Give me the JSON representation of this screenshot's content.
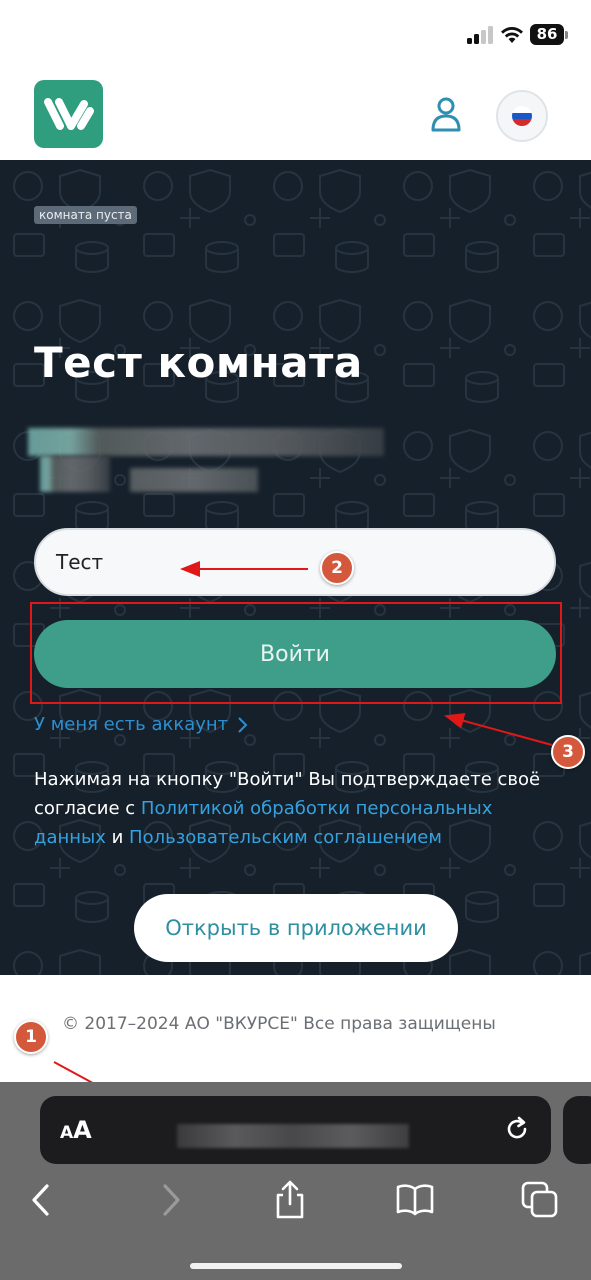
{
  "status_bar": {
    "battery": "86"
  },
  "header": {
    "logo_icon": "app-logo-icon",
    "user_icon": "user-icon",
    "language_icon": "russian-flag-icon"
  },
  "room": {
    "badge": "комната пуста",
    "title": "Тест комната"
  },
  "form": {
    "name_value": "Тест",
    "login_button": "Войти",
    "have_account": "У меня есть аккаунт",
    "consent_prefix": "Нажимая на кнопку \"Войти\" Вы подтверждаете своё согласие с ",
    "privacy_link": "Политикой обработки персональных данных",
    "consent_and": " и ",
    "terms_link": "Пользовательским соглашением",
    "open_app_button": "Открыть в приложении"
  },
  "footer": {
    "copyright": "© 2017–2024 АО \"ВКУРСЕ\" Все права защищены"
  },
  "annotations": {
    "marker1": "1",
    "marker2": "2",
    "marker3": "3"
  },
  "browser": {
    "text_size_label_small": "A",
    "text_size_label_big": "A"
  },
  "colors": {
    "brand": "#2e9e7e",
    "button": "#3e9e89",
    "hero_bg": "#15202b",
    "link": "#35a2e0",
    "marker": "#d4583c",
    "highlight": "#e01818"
  }
}
